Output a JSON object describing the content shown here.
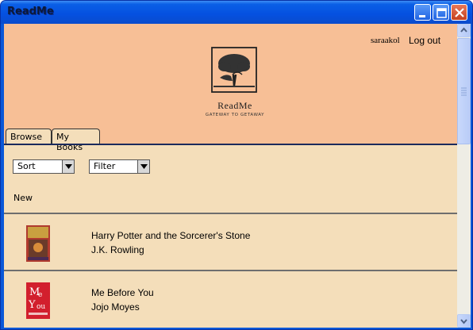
{
  "window": {
    "title": "ReadMe",
    "controls": [
      "minimize-icon",
      "maximize-icon",
      "close-icon"
    ]
  },
  "header": {
    "username": "saraakol",
    "logout_label": "Log out",
    "brand_name": "ReadMe",
    "tagline": "GATEWAY TO GETAWAY",
    "logo_icon": "tree-reader-logo"
  },
  "tabs": [
    {
      "label": "Browse",
      "active": true
    },
    {
      "label": "My Books",
      "active": false
    }
  ],
  "filters": {
    "sort_label": "Sort",
    "filter_label": "Filter"
  },
  "section_label": "New",
  "books": [
    {
      "title": "Harry Potter and the Sorcerer's Stone",
      "author": "J.K. Rowling",
      "cover_color": "#b03a2e"
    },
    {
      "title": "Me Before You",
      "author": "Jojo Moyes",
      "cover_color": "#d21f2d"
    }
  ],
  "colors": {
    "header_bg": "#f7bf96",
    "content_bg": "#f4deba",
    "titlebar": "#0a58d8"
  }
}
